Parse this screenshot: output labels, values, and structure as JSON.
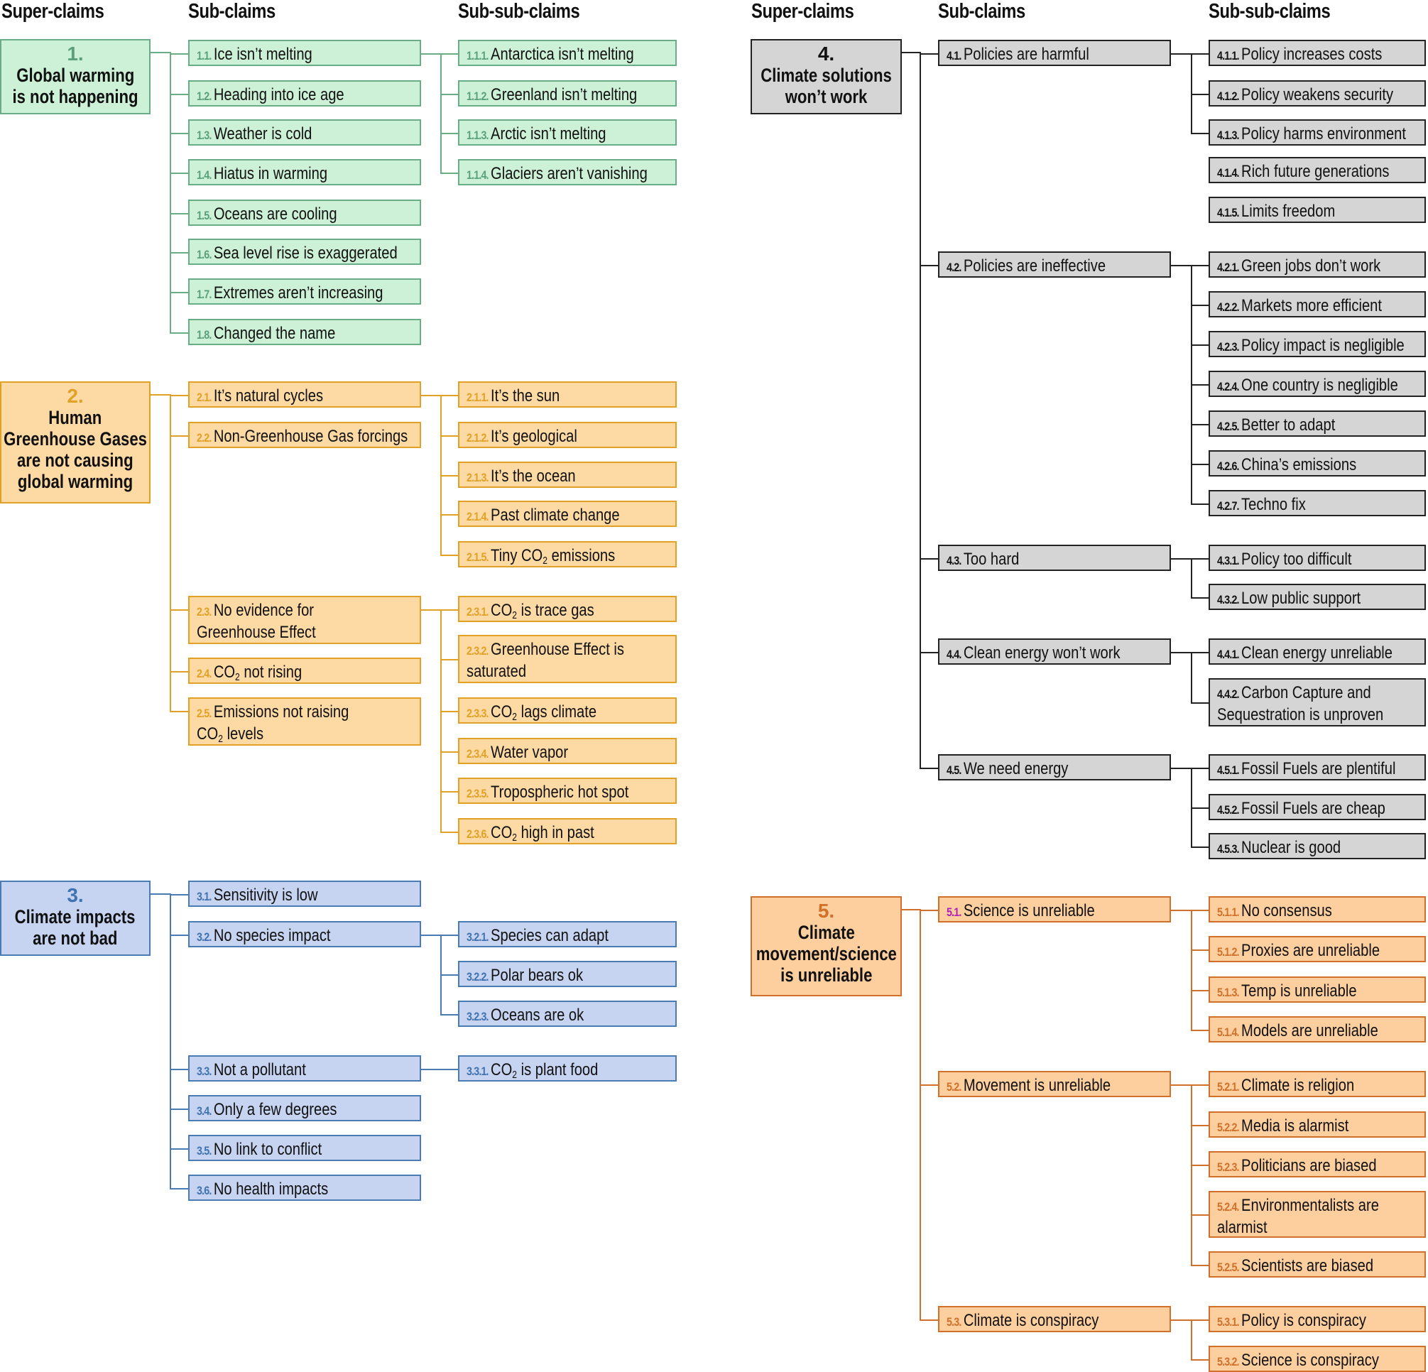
{
  "headers": {
    "left": {
      "super": "Super-claims",
      "sub": "Sub-claims",
      "subsub": "Sub-sub-claims"
    },
    "right": {
      "super": "Super-claims",
      "sub": "Sub-claims",
      "subsub": "Sub-sub-claims"
    }
  },
  "colors": {
    "g1": {
      "fill": "#cdf1d6",
      "line": "#69ad87",
      "label": "#5aa07a"
    },
    "g2": {
      "fill": "#fdd9a3",
      "line": "#e0a126",
      "label": "#e0a126"
    },
    "g3": {
      "fill": "#c6d4f1",
      "line": "#4a7bb3",
      "label": "#3f72b0"
    },
    "g4": {
      "fill": "#d6d5d6",
      "line": "#222222",
      "label": "#111111"
    },
    "g5": {
      "fill": "#fdcf9e",
      "line": "#d0702a",
      "label": "#d0702a",
      "label_5_1": "#b01fb5"
    }
  },
  "groups": [
    {
      "id": "1",
      "num": "1.",
      "title_lines": [
        "Global warming",
        "is not happening"
      ],
      "subs": [
        {
          "num": "1.1.",
          "text": "Ice isn’t melting",
          "children": [
            {
              "num": "1.1.1.",
              "text": "Antarctica isn’t melting"
            },
            {
              "num": "1.1.2.",
              "text": "Greenland isn’t melting"
            },
            {
              "num": "1.1.3.",
              "text": "Arctic isn’t melting"
            },
            {
              "num": "1.1.4.",
              "text": "Glaciers aren’t vanishing"
            }
          ]
        },
        {
          "num": "1.2.",
          "text": "Heading into ice age",
          "children": []
        },
        {
          "num": "1.3.",
          "text": "Weather is cold",
          "children": []
        },
        {
          "num": "1.4.",
          "text": "Hiatus in warming",
          "children": []
        },
        {
          "num": "1.5.",
          "text": "Oceans are cooling",
          "children": []
        },
        {
          "num": "1.6.",
          "text": "Sea level rise is exaggerated",
          "children": []
        },
        {
          "num": "1.7.",
          "text": "Extremes aren’t increasing",
          "children": []
        },
        {
          "num": "1.8.",
          "text": "Changed the name",
          "children": []
        }
      ]
    },
    {
      "id": "2",
      "num": "2.",
      "title_lines": [
        "Human",
        "Greenhouse Gases",
        "are not causing",
        "global warming"
      ],
      "subs": [
        {
          "num": "2.1.",
          "text": "It’s natural cycles",
          "children": [
            {
              "num": "2.1.1.",
              "text": "It’s the sun"
            },
            {
              "num": "2.1.2.",
              "text": "It’s geological"
            },
            {
              "num": "2.1.3.",
              "text": "It’s the ocean"
            },
            {
              "num": "2.1.4.",
              "text": "Past climate change"
            },
            {
              "num": "2.1.5.",
              "text": "Tiny CO₂ emissions"
            }
          ]
        },
        {
          "num": "2.2.",
          "text": "Non-Greenhouse Gas forcings",
          "children": []
        },
        {
          "num": "2.3.",
          "text": "No evidence for Greenhouse Effect",
          "children": [
            {
              "num": "2.3.1.",
              "text": "CO₂ is trace gas"
            },
            {
              "num": "2.3.2.",
              "text": "Greenhouse Effect is saturated"
            },
            {
              "num": "2.3.3.",
              "text": "CO₂ lags climate"
            },
            {
              "num": "2.3.4.",
              "text": "Water vapor"
            },
            {
              "num": "2.3.5.",
              "text": "Tropospheric hot spot"
            },
            {
              "num": "2.3.6.",
              "text": "CO₂ high in past"
            }
          ]
        },
        {
          "num": "2.4.",
          "text": "CO₂ not rising",
          "children": []
        },
        {
          "num": "2.5.",
          "text": "Emissions not raising CO₂ levels",
          "children": []
        }
      ]
    },
    {
      "id": "3",
      "num": "3.",
      "title_lines": [
        "Climate impacts",
        "are not bad"
      ],
      "subs": [
        {
          "num": "3.1.",
          "text": "Sensitivity is low",
          "children": []
        },
        {
          "num": "3.2.",
          "text": "No species impact",
          "children": [
            {
              "num": "3.2.1.",
              "text": "Species can adapt"
            },
            {
              "num": "3.2.2.",
              "text": "Polar bears ok"
            },
            {
              "num": "3.2.3.",
              "text": "Oceans are ok"
            }
          ]
        },
        {
          "num": "3.3.",
          "text": "Not a pollutant",
          "children": [
            {
              "num": "3.3.1.",
              "text": "CO₂ is plant food"
            }
          ]
        },
        {
          "num": "3.4.",
          "text": "Only a few degrees",
          "children": []
        },
        {
          "num": "3.5.",
          "text": "No link to conflict",
          "children": []
        },
        {
          "num": "3.6.",
          "text": "No health impacts",
          "children": []
        }
      ]
    },
    {
      "id": "4",
      "num": "4.",
      "title_lines": [
        "Climate solutions",
        "won’t work"
      ],
      "subs": [
        {
          "num": "4.1.",
          "text": "Policies are harmful",
          "children": [
            {
              "num": "4.1.1.",
              "text": "Policy increases costs"
            },
            {
              "num": "4.1.2.",
              "text": "Policy weakens security"
            },
            {
              "num": "4.1.3.",
              "text": "Policy harms environment"
            },
            {
              "num": "4.1.4.",
              "text": "Rich future generations"
            },
            {
              "num": "4.1.5.",
              "text": "Limits freedom"
            }
          ]
        },
        {
          "num": "4.2.",
          "text": "Policies are ineffective",
          "children": [
            {
              "num": "4.2.1.",
              "text": "Green jobs don’t work"
            },
            {
              "num": "4.2.2.",
              "text": "Markets more efficient"
            },
            {
              "num": "4.2.3.",
              "text": "Policy impact is negligible"
            },
            {
              "num": "4.2.4.",
              "text": "One country is negligible"
            },
            {
              "num": "4.2.5.",
              "text": "Better to adapt"
            },
            {
              "num": "4.2.6.",
              "text": "China’s emissions"
            },
            {
              "num": "4.2.7.",
              "text": "Techno fix"
            }
          ]
        },
        {
          "num": "4.3.",
          "text": "Too hard",
          "children": [
            {
              "num": "4.3.1.",
              "text": "Policy too difficult"
            },
            {
              "num": "4.3.2.",
              "text": "Low public support"
            }
          ]
        },
        {
          "num": "4.4.",
          "text": "Clean energy won’t work",
          "children": [
            {
              "num": "4.4.1.",
              "text": "Clean energy unreliable"
            },
            {
              "num": "4.4.2.",
              "text": "Carbon Capture and Sequestration is unproven"
            }
          ]
        },
        {
          "num": "4.5.",
          "text": "We need energy",
          "children": [
            {
              "num": "4.5.1.",
              "text": "Fossil Fuels are plentiful"
            },
            {
              "num": "4.5.2.",
              "text": "Fossil Fuels are cheap"
            },
            {
              "num": "4.5.3.",
              "text": "Nuclear is good"
            }
          ]
        }
      ]
    },
    {
      "id": "5",
      "num": "5.",
      "title_lines": [
        "Climate",
        "movement/science",
        "is unreliable"
      ],
      "subs": [
        {
          "num": "5.1.",
          "text": "Science is unreliable",
          "children": [
            {
              "num": "5.1.1.",
              "text": "No consensus"
            },
            {
              "num": "5.1.2.",
              "text": "Proxies are unreliable"
            },
            {
              "num": "5.1.3.",
              "text": "Temp is unreliable"
            },
            {
              "num": "5.1.4.",
              "text": "Models are unreliable"
            }
          ]
        },
        {
          "num": "5.2.",
          "text": "Movement is unreliable",
          "children": [
            {
              "num": "5.2.1.",
              "text": "Climate is religion"
            },
            {
              "num": "5.2.2.",
              "text": "Media is alarmist"
            },
            {
              "num": "5.2.3.",
              "text": "Politicians are biased"
            },
            {
              "num": "5.2.4.",
              "text": "Environmentalists are alarmist"
            },
            {
              "num": "5.2.5.",
              "text": "Scientists are biased"
            }
          ]
        },
        {
          "num": "5.3.",
          "text": "Climate is conspiracy",
          "children": [
            {
              "num": "5.3.1.",
              "text": "Policy is conspiracy"
            },
            {
              "num": "5.3.2.",
              "text": "Science is conspiracy"
            }
          ]
        }
      ]
    }
  ]
}
